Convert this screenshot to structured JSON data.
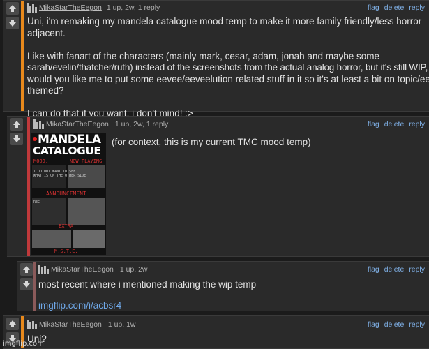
{
  "vote_icons": {
    "up": "up-arrow-icon",
    "down": "down-arrow-icon"
  },
  "actions": {
    "flag": "flag",
    "delete": "delete",
    "reply": "reply"
  },
  "comments": [
    {
      "user": "MikaStarTheEegon",
      "info": "1 up, 2w, 1 reply",
      "accent": "#e8891c",
      "lines": [
        "Uni, i'm remaking my mandela catalogue mood temp to make it more family friendly/less horror",
        "adjacent.",
        "",
        "Like with fanart of the characters (mainly mark, cesar, adam, jonah and maybe some",
        "sarah/evelin/thatcher/ruth) instead of the screenshots from the actual analog horror, but it's still WIP, so",
        "would you like me to put some eevee/eeveelution related stuff in it so it's at least a bit on topic/eevee",
        "themed?",
        "",
        "I can do that if you want, i don't mind! :>"
      ]
    },
    {
      "user": "MikaStarTheEegon",
      "info": "1 up, 2w, 1 reply",
      "accent": "#c0393b",
      "text": "(for context, this is my current TMC mood temp)",
      "image": {
        "title1": "MANDELA",
        "title2": "CATALOGUE",
        "labels": [
          "MOOD.",
          "NOW PLAYING",
          "ANNOUNCEMENT",
          "EXTRA",
          "M.S.T.E.",
          "I DO NOT WANT TO SEE",
          "WHAT IS ON THE OTHER SIDE",
          "REC"
        ]
      }
    },
    {
      "user": "MikaStarTheEegon",
      "info": "1 up, 2w",
      "accent": "#8a5a5a",
      "text": "most recent where i mentioned making the wip temp",
      "link": "imgflip.com/i/acbsr4"
    },
    {
      "user": "MikaStarTheEegon",
      "info": "1 up, 1w",
      "accent": "#e8891c",
      "text": "Uni?"
    }
  ],
  "watermark": "imgflip.com"
}
